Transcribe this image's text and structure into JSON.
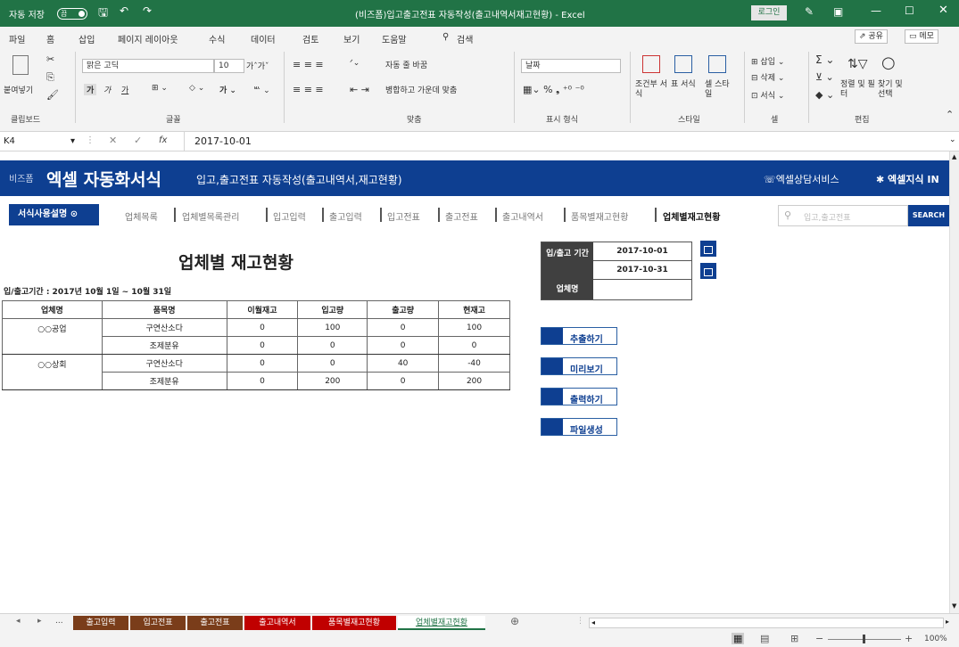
{
  "titlebar": {
    "autosave": "자동 저장",
    "autosave_state": "끔",
    "doc_title": "(비즈폼)입고출고전표 자동작성(출고내역서재고현황) - Excel",
    "login": "로그인"
  },
  "menu": {
    "items": [
      "파일",
      "홈",
      "삽입",
      "페이지 레이아웃",
      "수식",
      "데이터",
      "검토",
      "보기",
      "도움말"
    ],
    "search": "검색",
    "share": "공유",
    "memo": "메모"
  },
  "ribbon": {
    "clipboard": {
      "paste": "붙여넣기",
      "label": "클립보드"
    },
    "font": {
      "name": "맑은 고딕",
      "size": "10",
      "bold": "가",
      "italic": "가",
      "underline": "가",
      "label": "글꼴"
    },
    "align": {
      "wrap": "자동 줄 바꿈",
      "merge": "병합하고 가운데 맞춤",
      "label": "맞춤"
    },
    "number": {
      "format": "날짜",
      "label": "표시 형식"
    },
    "styles": {
      "cond": "조건부 서식",
      "table": "표 서식",
      "cell": "셀 스타일",
      "label": "스타일"
    },
    "cells": {
      "insert": "삽입",
      "delete": "삭제",
      "format": "서식",
      "label": "셀"
    },
    "edit": {
      "sort": "정렬 및 필터",
      "find": "찾기 및 선택",
      "label": "편집"
    }
  },
  "formula": {
    "namebox": "K4",
    "fx": "fx",
    "value": "2017-10-01"
  },
  "header": {
    "brand_prefix": "비즈폼",
    "brand": "엑셀 자동화서식",
    "subtitle": "입고,출고전표 자동작성(출고내역서,재고현황)",
    "service": "엑셀상담서비스",
    "knowledge": "엑셀지식 IN"
  },
  "nav": {
    "guide": "서식사용설명",
    "items": [
      "업체목록",
      "업체별목록관리",
      "입고입력",
      "출고입력",
      "입고전표",
      "출고전표",
      "출고내역서",
      "품목별재고현황",
      "업체별재고현황"
    ],
    "search_placeholder": "입고,출고전표",
    "search_btn": "SEARCH"
  },
  "report": {
    "title": "업체별 재고현황",
    "period": "입/출고기간 : 2017년 10월 1일 ~ 10월 31일",
    "columns": [
      "업체명",
      "품목명",
      "이월재고",
      "입고량",
      "출고량",
      "현재고"
    ],
    "rows": [
      [
        "○○공업",
        "구연산소다",
        "0",
        "100",
        "0",
        "100"
      ],
      [
        "",
        "조제분유",
        "0",
        "0",
        "0",
        "0"
      ],
      [
        "○○상회",
        "구연산소다",
        "0",
        "0",
        "40",
        "-40"
      ],
      [
        "",
        "조제분유",
        "0",
        "200",
        "0",
        "200"
      ]
    ]
  },
  "filter": {
    "label_period": "입/출고 기간",
    "start": "2017-10-01",
    "end": "2017-10-31",
    "label_company": "업체명",
    "company": ""
  },
  "actions": {
    "extract": "추출하기",
    "preview": "미리보기",
    "print": "출력하기",
    "file": "파일생성"
  },
  "tabs": {
    "ellipsis": "...",
    "items": [
      "출고입력",
      "입고전표",
      "출고전표",
      "출고내역서",
      "품목별재고현황",
      "업체별재고현황"
    ],
    "colors": [
      "#7a3d1a",
      "#7a3d1a",
      "#7a3d1a",
      "#c00000",
      "#c00000",
      "#ffffff"
    ]
  },
  "status": {
    "zoom": "100%"
  }
}
